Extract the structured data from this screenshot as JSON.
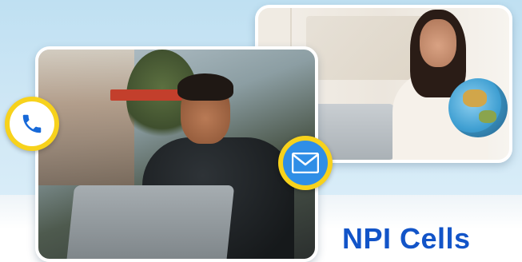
{
  "hero": {
    "headline": "NPI Cells",
    "colors": {
      "accent_blue": "#1254c8",
      "badge_yellow": "#f7d21c",
      "mail_blue": "#2f8ee6",
      "sky_bg": "#cfe7f5"
    },
    "icons": {
      "phone": "phone-icon",
      "mail": "mail-icon"
    }
  },
  "photos": [
    {
      "subject": "man-on-phone-photo"
    },
    {
      "subject": "woman-with-globe-photo"
    }
  ]
}
